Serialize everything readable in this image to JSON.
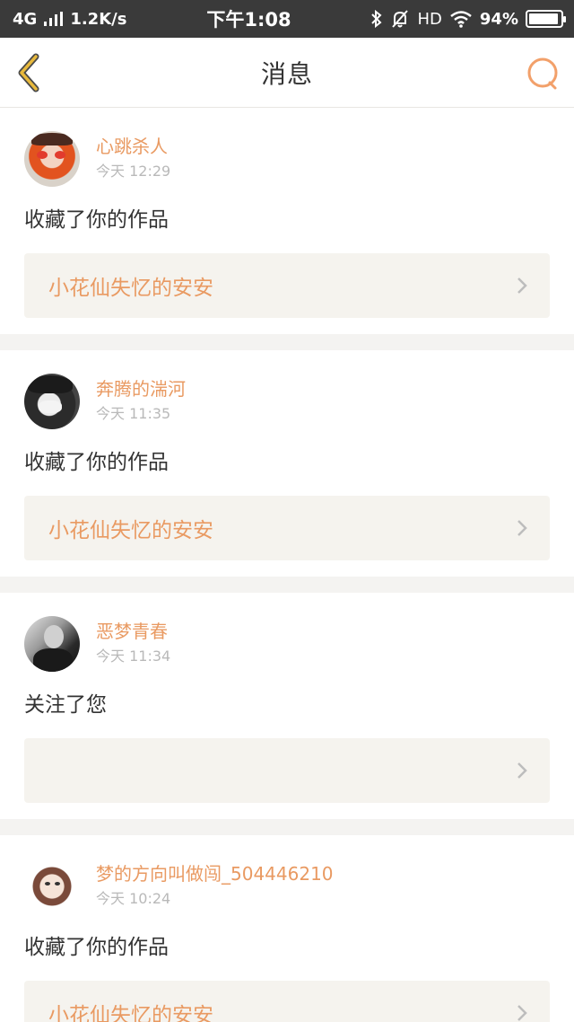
{
  "status_bar": {
    "network": "4G",
    "speed": "1.2K/s",
    "time": "下午1:08",
    "hd": "HD",
    "battery": "94%",
    "battery_level": 0.94
  },
  "header": {
    "title": "消息"
  },
  "messages": [
    {
      "username": "心跳杀人",
      "time": "今天 12:29",
      "action": "收藏了你的作品",
      "work_title": "小花仙失忆的安安"
    },
    {
      "username": "奔腾的湍河",
      "time": "今天 11:35",
      "action": "收藏了你的作品",
      "work_title": "小花仙失忆的安安"
    },
    {
      "username": "恶梦青春",
      "time": "今天 11:34",
      "action": "关注了您",
      "work_title": ""
    },
    {
      "username": "梦的方向叫做闯_504446210",
      "time": "今天 10:24",
      "action": "收藏了你的作品",
      "work_title": "小花仙失忆的安安"
    }
  ],
  "colors": {
    "accent": "#e99a62",
    "back_icon": "#e8b93c",
    "search_icon": "#f2a06a"
  }
}
